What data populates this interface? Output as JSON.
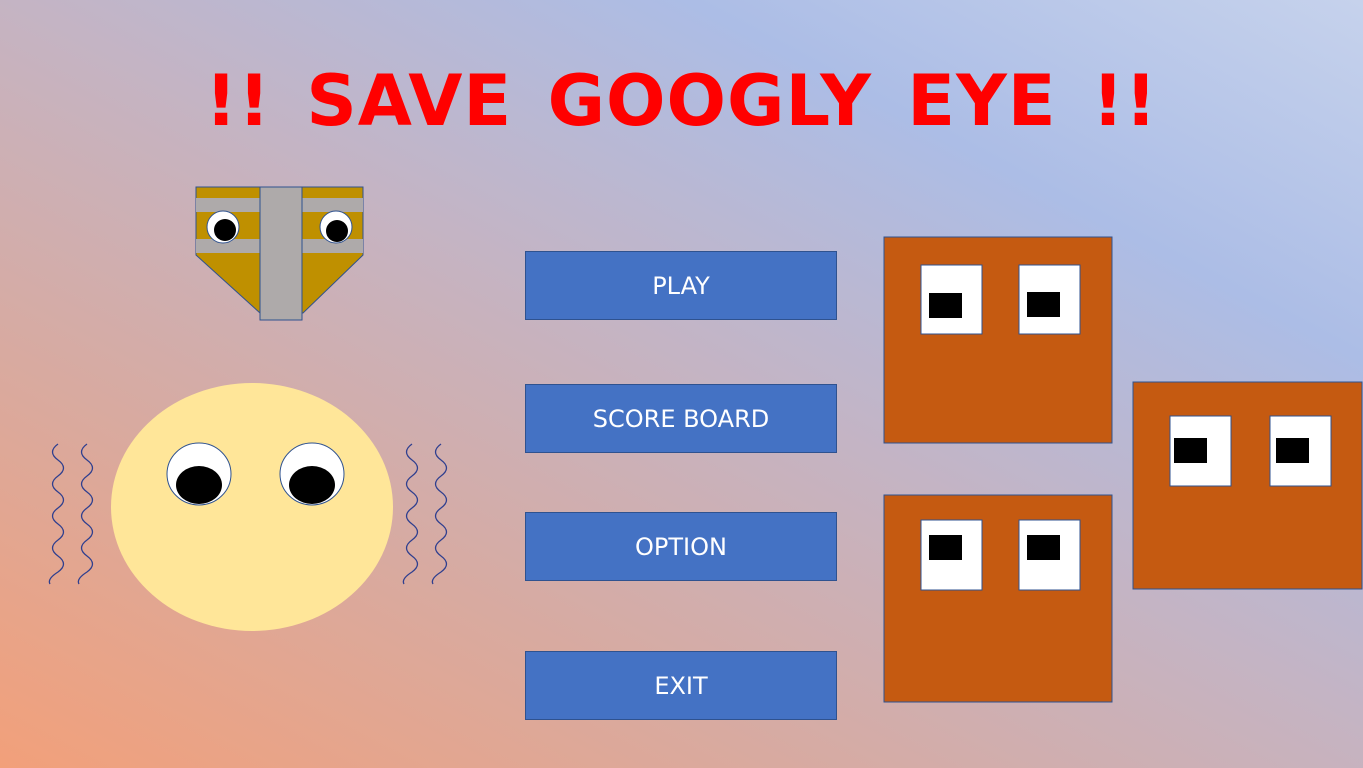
{
  "title": "!! SAVE GOOGLY EYE !!",
  "menu": {
    "play_label": "PLAY",
    "score_board_label": "SCORE BOARD",
    "option_label": "OPTION",
    "exit_label": "EXIT"
  },
  "colors": {
    "title": "#ff0000",
    "button": "#4472c4",
    "monster": "#c55a11",
    "shield_gold": "#bf9000",
    "shield_gray": "#aeaaaa",
    "face": "#ffe699",
    "shake_lines": "#2f3f8f"
  },
  "sprites": {
    "shield_enemy": "shield-enemy-sprite",
    "googly_face": "googly-eye-face-sprite",
    "block_monsters": [
      "block-monster-sprite",
      "block-monster-sprite",
      "block-monster-sprite"
    ]
  }
}
